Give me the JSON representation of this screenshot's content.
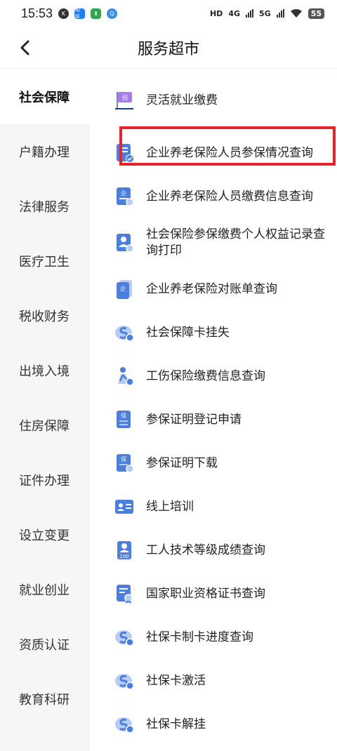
{
  "status_bar": {
    "time": "15:53",
    "mini_icons": [
      "K",
      "知乎",
      "⬆",
      "Q"
    ],
    "network": [
      "HD",
      "4G",
      "5G"
    ],
    "battery": "55"
  },
  "header": {
    "title": "服务超市",
    "back_icon": "chevron-left-icon"
  },
  "sidebar": {
    "items": [
      {
        "label": "社会保障",
        "active": true
      },
      {
        "label": "户籍办理"
      },
      {
        "label": "法律服务"
      },
      {
        "label": "医疗卫生"
      },
      {
        "label": "税收财务"
      },
      {
        "label": "出境入境"
      },
      {
        "label": "住房保障"
      },
      {
        "label": "证件办理"
      },
      {
        "label": "设立变更"
      },
      {
        "label": "就业创业"
      },
      {
        "label": "资质认证"
      },
      {
        "label": "教育科研"
      }
    ]
  },
  "services": {
    "items": [
      {
        "label": "灵活就业缴费",
        "icon": "flag-icon",
        "badge": "招"
      },
      {
        "label": "企业养老保险人员参保情况查询",
        "icon": "document-check-icon",
        "badge": "养",
        "highlighted": true
      },
      {
        "label": "企业养老保险人员缴费信息查询",
        "icon": "document-enterprise-icon",
        "badge": "企"
      },
      {
        "label": "社会保险参保缴费个人权益记录查询打印",
        "icon": "person-document-icon",
        "badge": ""
      },
      {
        "label": "企业养老保险对账单查询",
        "icon": "document-enterprise-icon",
        "badge": "企"
      },
      {
        "label": "社会保障卡挂失",
        "icon": "social-security-card-icon",
        "badge": ""
      },
      {
        "label": "工伤保险缴费信息查询",
        "icon": "injury-person-icon",
        "badge": ""
      },
      {
        "label": "参保证明登记申请",
        "icon": "document-insurance-icon",
        "badge": "保"
      },
      {
        "label": "参保证明下载",
        "icon": "document-download-icon",
        "badge": "保"
      },
      {
        "label": "线上培训",
        "icon": "id-card-icon",
        "badge": ""
      },
      {
        "label": "工人技术等级成绩查询",
        "icon": "worker-score-icon",
        "badge": "100"
      },
      {
        "label": "国家职业资格证书查询",
        "icon": "certificate-icon",
        "badge": ""
      },
      {
        "label": "社保卡制卡进度查询",
        "icon": "social-security-card-icon",
        "badge": ""
      },
      {
        "label": "社保卡激活",
        "icon": "social-security-card-icon",
        "badge": ""
      },
      {
        "label": "社保卡解挂",
        "icon": "social-security-card-icon",
        "badge": ""
      }
    ]
  },
  "colors": {
    "accent": "#4a7fe0",
    "icon_light": "#b7cdf5",
    "highlight_border": "#e5232a",
    "sidebar_bg": "#f5f6f8"
  }
}
